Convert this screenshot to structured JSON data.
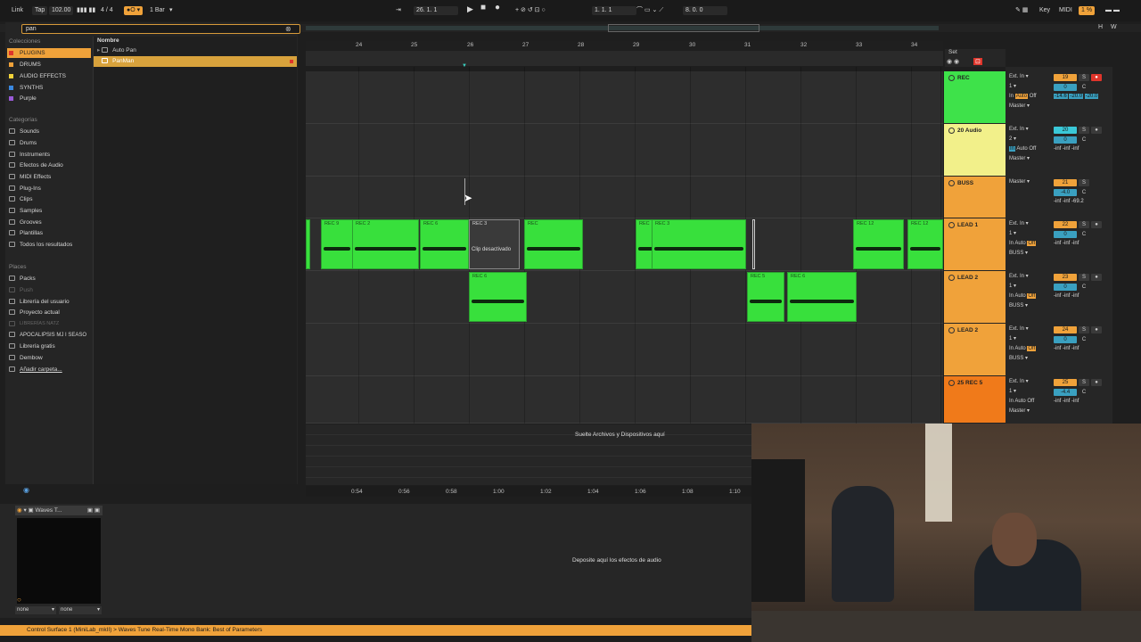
{
  "transport": {
    "link": "Link",
    "tap": "Tap",
    "tempo": "102.00",
    "signature": "4 / 4",
    "quantize": "1 Bar",
    "position": "26.  1.  1",
    "loop_start": "1.  1.  1",
    "loop_length": "8.  0.  0",
    "key": "Key",
    "midi": "MIDI",
    "cpu": "1 %",
    "h": "H",
    "w": "W"
  },
  "browser": {
    "search_value": "pan",
    "collections_label": "Colecciones",
    "collections": [
      {
        "label": "PLUGINS",
        "color": "#e0352b"
      },
      {
        "label": "DRUMS",
        "color": "#f0a23a"
      },
      {
        "label": "AUDIO EFFECTS",
        "color": "#f2d23a"
      },
      {
        "label": "SYNTHS",
        "color": "#3a88e0"
      },
      {
        "label": "Purple",
        "color": "#9a5ad8"
      }
    ],
    "categories_label": "Categorías",
    "categories": [
      "Sounds",
      "Drums",
      "Instruments",
      "Efectos de Audio",
      "MIDI Effects",
      "Plug-Ins",
      "Clips",
      "Samples",
      "Grooves",
      "Plantillas",
      "Todos los resultados"
    ],
    "places_label": "Places",
    "places": [
      "Packs",
      "Push",
      "Librería del usuario",
      "Proyecto actual",
      "LIBRERÍAS NATZ",
      "APOCALIPSIS MJ I SEASO",
      "Librería gratis",
      "Dembow",
      "Añadir carpeta..."
    ],
    "name_header": "Nombre",
    "results": [
      "Auto Pan",
      "PanMan"
    ]
  },
  "ruler": {
    "bars": [
      "24",
      "25",
      "26",
      "27",
      "28",
      "29",
      "30",
      "31",
      "32",
      "33",
      "34"
    ],
    "times": [
      "0:54",
      "0:56",
      "0:58",
      "1:00",
      "1:02",
      "1:04",
      "1:06",
      "1:08",
      "1:10"
    ]
  },
  "set_label": "Set",
  "drop_files": "Suelte Archivos y Dispositivos aquí",
  "drop_effects": "Deposite aquí los efectos de audio",
  "disabled_clip_text": "Clip desactivado",
  "clips_lead1": [
    "REC 9",
    "REC 2",
    "REC 6",
    "REC 3",
    "REC",
    "REC",
    "REC 3",
    "REC 12",
    "REC 12"
  ],
  "clips_lead2": [
    "REC 6",
    "REC 5",
    "REC 6"
  ],
  "tracks": [
    {
      "name": "REC",
      "color": "#3ee24a",
      "input": "Ext. In",
      "channel": "1",
      "mon_in": "In",
      "mon_auto": "Auto",
      "mon_off": "Off",
      "output": "Master",
      "number": "19",
      "volume": "0",
      "pan": "C",
      "solo": "S",
      "peak1": "-14.6",
      "peak2": "-20.0",
      "peak3": "-20.0"
    },
    {
      "name": "20 Audio",
      "color": "#f2f08a",
      "input": "Ext. In",
      "channel": "2",
      "mon_in": "In",
      "mon_auto": "Auto",
      "mon_off": "Off",
      "output": "Master",
      "number": "20",
      "volume": "0",
      "pan": "C",
      "solo": "S",
      "peak1": "-inf",
      "peak2": "-inf",
      "peak3": "-inf"
    },
    {
      "name": "BUSS",
      "color": "#f0a23a",
      "input": "",
      "channel": "",
      "mon_in": "",
      "mon_auto": "",
      "mon_off": "",
      "output": "Master",
      "number": "21",
      "volume": "-4.0",
      "pan": "C",
      "solo": "S",
      "peak1": "-inf",
      "peak2": "-inf",
      "peak3": "-69.2"
    },
    {
      "name": "LEAD 1",
      "color": "#f0a23a",
      "input": "Ext. In",
      "channel": "1",
      "mon_in": "In",
      "mon_auto": "Auto",
      "mon_off": "Off",
      "output": "BUSS",
      "number": "22",
      "volume": "0",
      "pan": "C",
      "solo": "S",
      "peak1": "-inf",
      "peak2": "-inf",
      "peak3": "-inf"
    },
    {
      "name": "LEAD 2",
      "color": "#f0a23a",
      "input": "Ext. In",
      "channel": "1",
      "mon_in": "In",
      "mon_auto": "Auto",
      "mon_off": "Off",
      "output": "BUSS",
      "number": "23",
      "volume": "0",
      "pan": "C",
      "solo": "S",
      "peak1": "-inf",
      "peak2": "-inf",
      "peak3": "-inf"
    },
    {
      "name": "LEAD 2",
      "color": "#f0a23a",
      "input": "Ext. In",
      "channel": "1",
      "mon_in": "In",
      "mon_auto": "Auto",
      "mon_off": "Off",
      "output": "BUSS",
      "number": "24",
      "volume": "0",
      "pan": "C",
      "solo": "S",
      "peak1": "-inf",
      "peak2": "-inf",
      "peak3": "-inf"
    },
    {
      "name": "25 REC 5",
      "color": "#f07a1a",
      "input": "Ext. In",
      "channel": "1",
      "mon_in": "In",
      "mon_auto": "Auto",
      "mon_off": "Off",
      "output": "Master",
      "number": "25",
      "volume": "-4.4",
      "pan": "C",
      "solo": "S",
      "peak1": "-inf",
      "peak2": "-inf",
      "peak3": "-inf"
    }
  ],
  "device": {
    "title": "Waves T...",
    "macro1": "none",
    "macro2": "none"
  },
  "status_bar": "Control Surface 1 (MiniLab_mkII) > Waves Tune Real-Time Mono Bank: Best of Parameters"
}
